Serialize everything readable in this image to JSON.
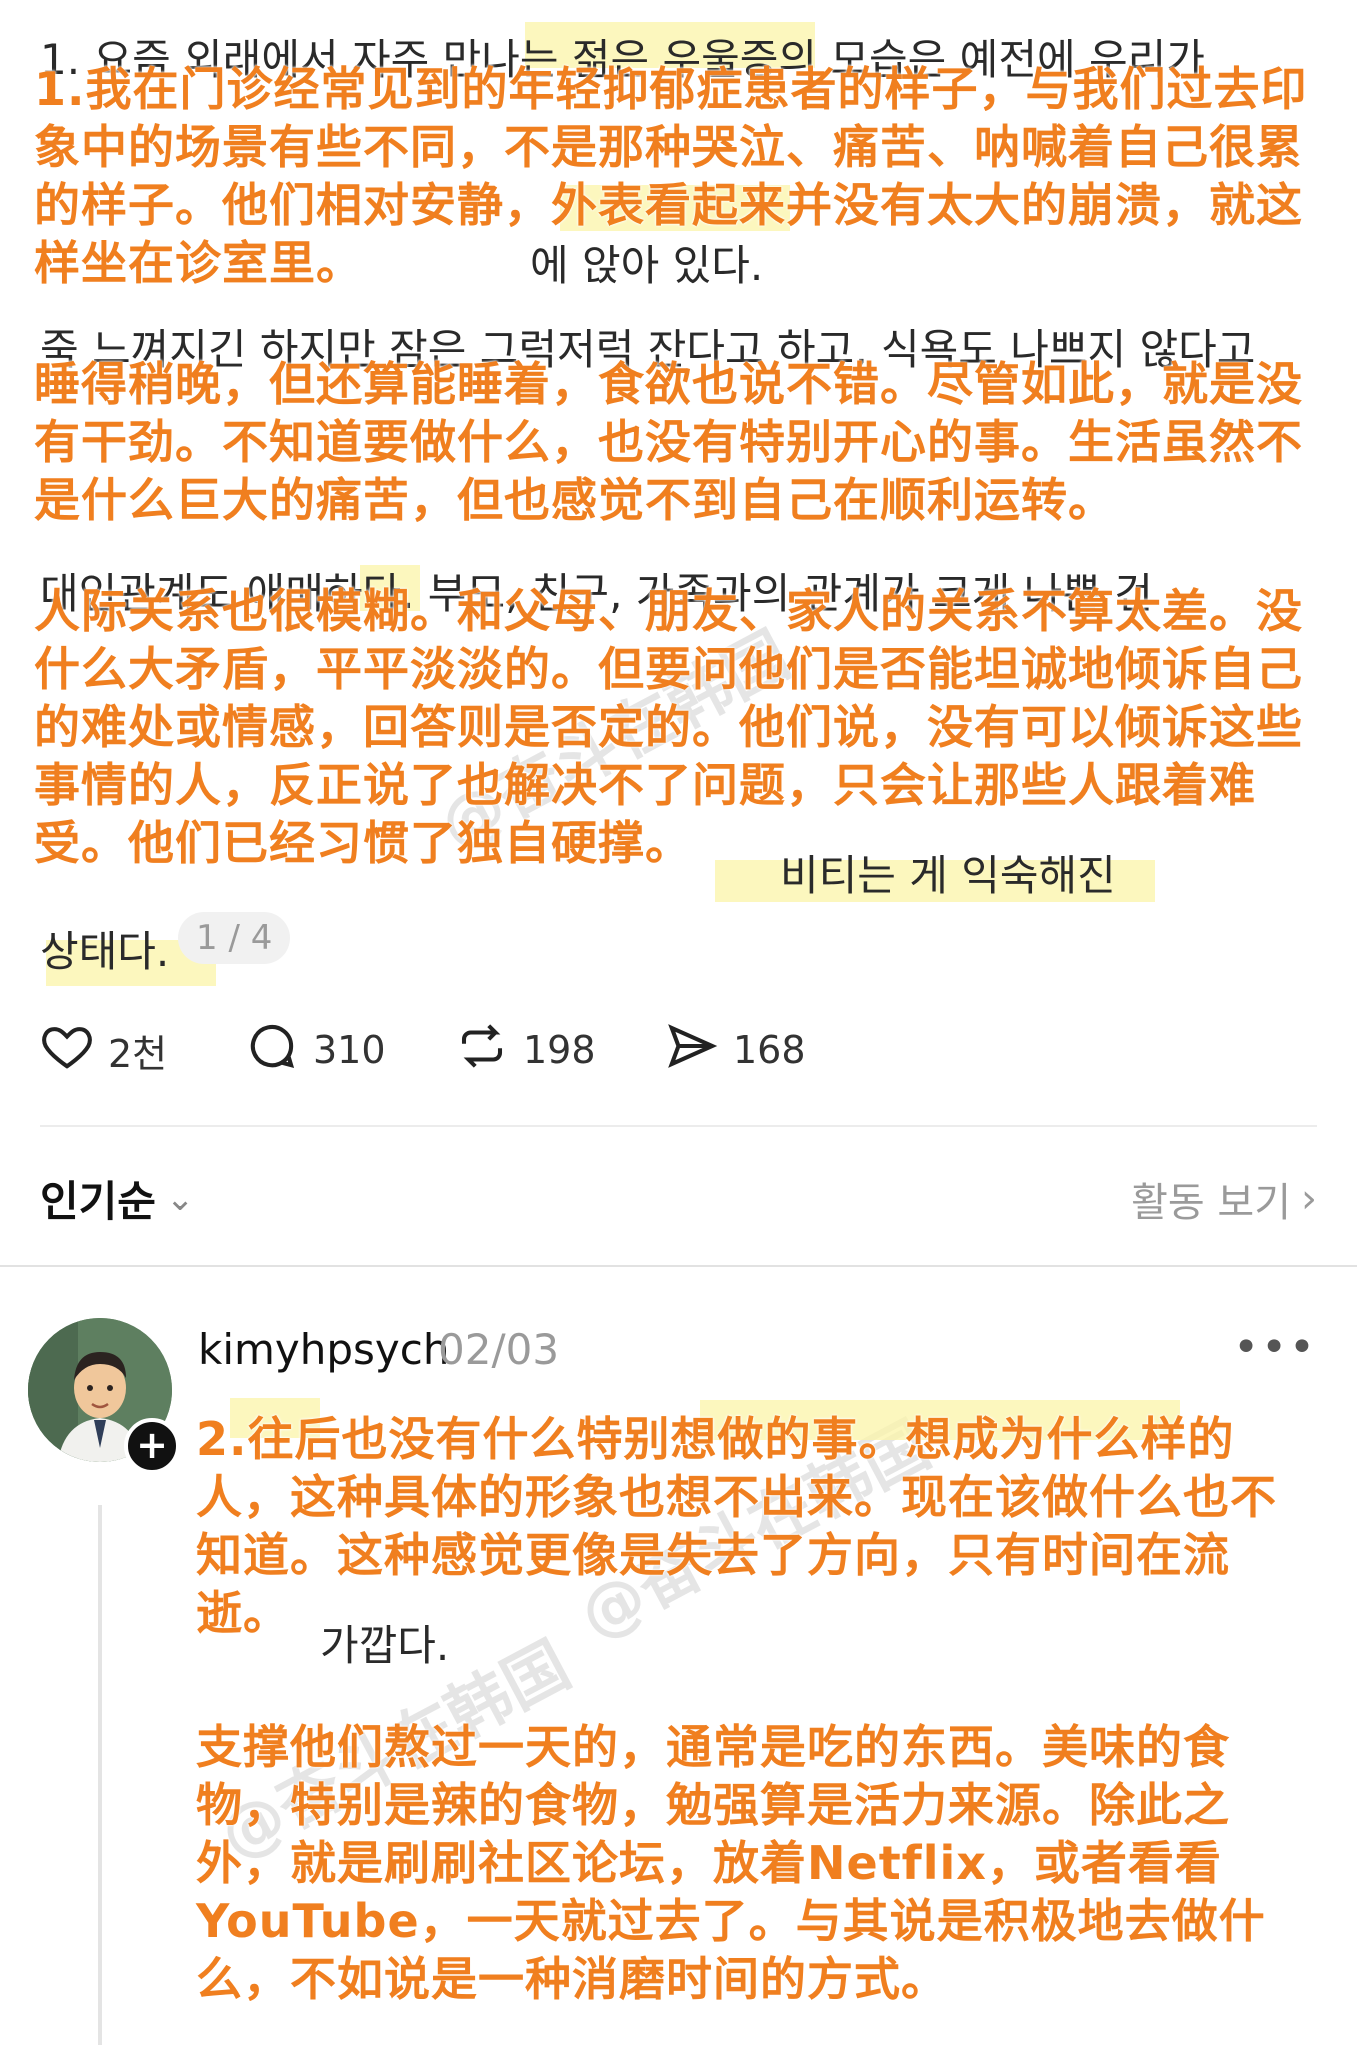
{
  "post": {
    "ko_lines": [
      "1. 요즘 외래에서 자주 만나는 젊은 우울증의 모습은 예전에 우리가",
      "에 앉아 있다.",
      "죽 느껴지긴 하지만 잠은 그럭저럭 잔다고 하고, 식욕도 나쁘지 않다고",
      "대인관계도 애매하다. 부모, 친구, 가족과의 관계가 크게 나쁜 건",
      "비티는 게 익숙해진",
      "상태다."
    ],
    "zh_paragraphs": [
      "1.我在门诊经常见到的年轻抑郁症患者的样子，与我们过去印象中的场景有些不同，不是那种哭泣、痛苦、呐喊着自己很累的样子。他们相对安静，外表看起来并没有太大的崩溃，就这样坐在诊室里。",
      "睡得稍晚，但还算能睡着，食欲也说不错。尽管如此，就是没有干劲。不知道要做什么，也没有特别开心的事。生活虽然不是什么巨大的痛苦，但也感觉不到自己在顺利运转。",
      "人际关系也很模糊。和父母、朋友、家人的关系不算太差。没什么大矛盾，平平淡淡的。但要问他们是否能坦诚地倾诉自己的难处或情感，回答则是否定的。他们说，没有可以倾诉这些事情的人，反正说了也解决不了问题，只会让那些人跟着难受。他们已经习惯了独自硬撑。"
    ],
    "page_indicator": "1 / 4",
    "actions": {
      "likes": "2천",
      "comments": "310",
      "reposts": "198",
      "shares": "168"
    }
  },
  "sort": {
    "label": "인기순",
    "activity_label": "활동 보기"
  },
  "comment": {
    "username": "kimyhpsych",
    "date": "02/03",
    "ko_lines": [
      "가깝다."
    ],
    "zh_paragraphs": [
      "2.往后也没有什么特别想做的事。想成为什么样的人，这种具体的形象也想不出来。现在该做什么也不知道。这种感觉更像是失去了方向，只有时间在流逝。",
      "支撑他们熬过一天的，通常是吃的东西。美味的食物，特别是辣的食物，勉强算是活力来源。除此之外，就是刷刷社区论坛，放着Netflix，或者看看YouTube，一天就过去了。与其说是积极地去做什么，不如说是一种消磨时间的方式。"
    ]
  },
  "watermark": "@奋斗在韩国"
}
